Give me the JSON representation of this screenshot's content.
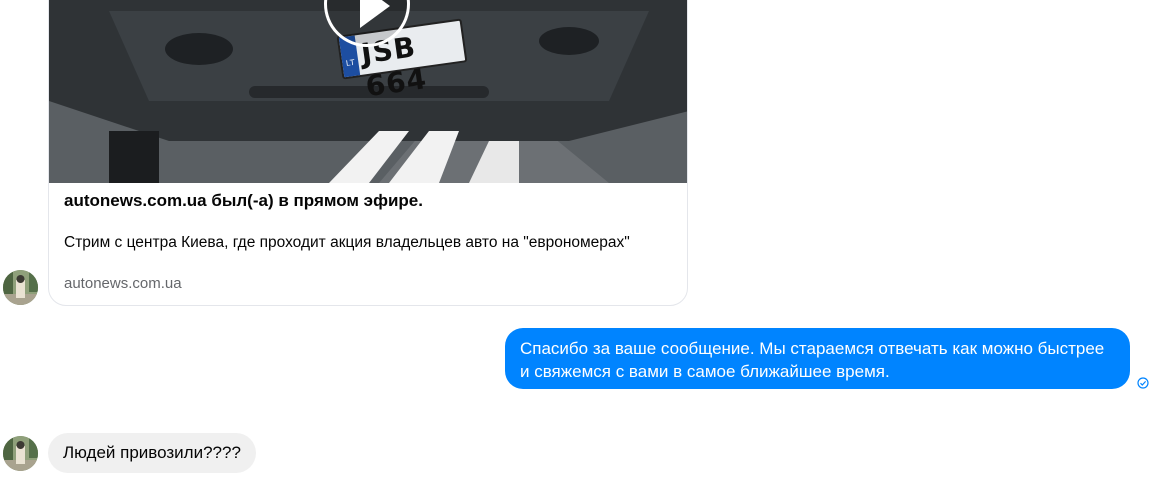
{
  "messages": [
    {
      "type": "link-preview",
      "video": {
        "plate_country": "LT",
        "plate_number": "JSB 664"
      },
      "title": "autonews.com.ua был(-а) в прямом эфире.",
      "description": "Стрим с центра Киева, где проходит акция владельцев авто на \"еврономерах\"",
      "domain": "autonews.com.ua"
    },
    {
      "type": "outgoing",
      "text": "Спасибо за ваше сообщение. Мы стараемся отвечать как можно быстрее и свяжемся с вами в самое ближайшее время."
    },
    {
      "type": "incoming",
      "text": "Людей привозили????"
    }
  ],
  "colors": {
    "outgoing_bubble": "#0084ff",
    "incoming_bubble": "#f0f0f0",
    "secondary_text": "#65676b"
  }
}
